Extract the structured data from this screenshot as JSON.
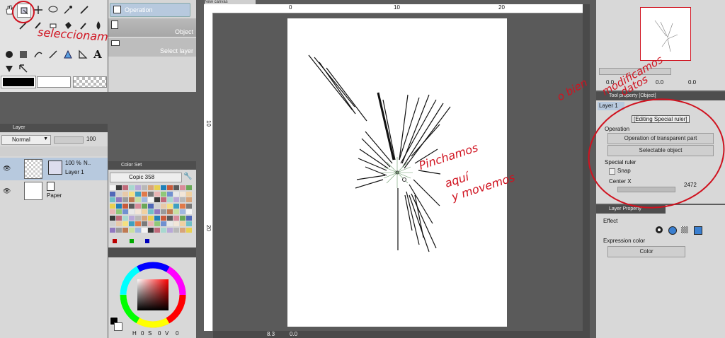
{
  "toolbar": {
    "left_tools": [
      "hand-icon",
      "object-icon",
      "move-icon",
      "lasso-icon",
      "magic-wand-icon",
      "eyedropper-icon",
      "pen-icon",
      "brush-icon",
      "eraser-icon",
      "fill-icon",
      "gradient-icon",
      "shape-icon",
      "text-icon",
      "balloon-icon",
      "ruler-icon",
      "spray-icon",
      "airbrush-icon"
    ],
    "main_color": "#000000",
    "sub_color": "#ffffff"
  },
  "tool_property": {
    "header": "Operation",
    "object_label": "Object",
    "select_layer_label": "Select layer"
  },
  "layer_panel": {
    "tab_label": "Layer",
    "blend_mode": "Normal",
    "opacity": "100",
    "layers": [
      {
        "percent": "100 %",
        "mode": "N..",
        "name": "Layer 1"
      },
      {
        "name": "Paper"
      }
    ]
  },
  "color_set": {
    "tab_label": "Color Set",
    "set_name": "Copic 358"
  },
  "color_wheel": {
    "h_label": "H",
    "h_value": "0",
    "s_label": "S",
    "s_value": "0",
    "v_label": "V",
    "v_value": "0"
  },
  "canvas": {
    "tab_label": "New canvas",
    "ruler_marks": [
      "0",
      "10",
      "20"
    ],
    "zoom": "8.3",
    "status_value": "0.0"
  },
  "navigator": {
    "slider_values": [
      "0.0",
      "0.0",
      "0.0"
    ]
  },
  "sub_tool_detail": {
    "tab_label": "Tool property [Object]",
    "layer_name": "Layer 1",
    "editing_label": "[Editing Special ruler]",
    "operation_label": "Operation",
    "operation_value": "Operation of transparent part",
    "selectable_value": "Selectable object",
    "special_ruler_label": "Special ruler",
    "snap_label": "Snap",
    "center_x_label": "Center X",
    "center_x_value": "2472"
  },
  "layer_property": {
    "tab_label": "Layer Property",
    "effect_label": "Effect",
    "expression_color_label": "Expression color",
    "expression_color_value": "Color"
  },
  "annotations": {
    "select_note": "seleccionamos",
    "click_note_1": "Pinchamos",
    "click_note_2": "aquí",
    "click_note_3": "y movemos",
    "modify_note_1": "modificamos",
    "modify_note_2": "datos",
    "modify_note_3": "o bien"
  },
  "colors": {
    "annotation_red": "#d0121f",
    "panel_bg": "#e3e3e3",
    "frame_dark": "#5c5c5c",
    "selection_blue": "#b7c9de"
  }
}
